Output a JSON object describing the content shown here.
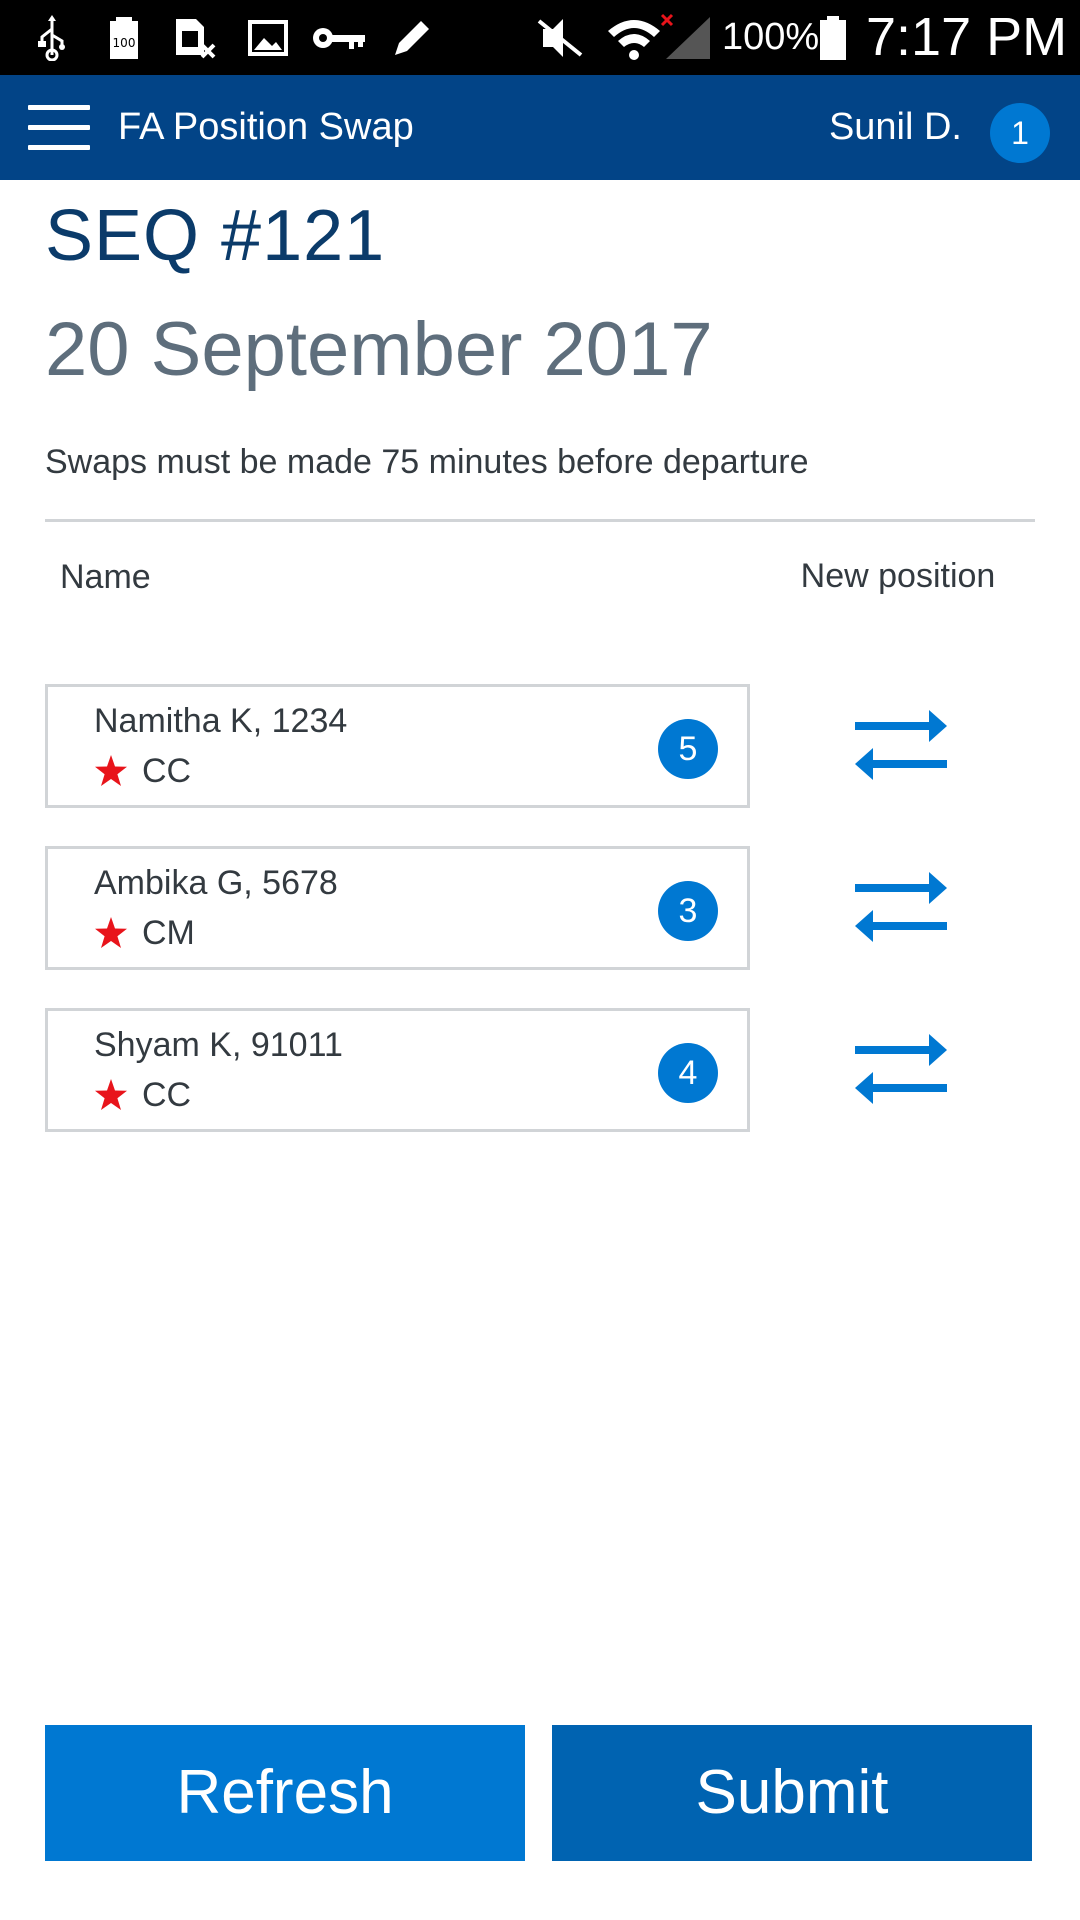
{
  "status_bar": {
    "battery_percent": "100%",
    "time": "7:17 PM",
    "icons": [
      "usb-icon",
      "battery-100-icon",
      "sim-card-x-icon",
      "image-icon",
      "key-icon",
      "pencil-icon",
      "mute-icon",
      "wifi-icon",
      "signal-no-service-icon",
      "battery-icon"
    ]
  },
  "app_bar": {
    "title": "FA Position Swap",
    "user_name": "Sunil D.",
    "user_badge": "1"
  },
  "sequence": {
    "title": "SEQ #121",
    "date": "20 September 2017",
    "note": "Swaps must be made 75 minutes before departure"
  },
  "table": {
    "col_name": "Name",
    "col_new_position": "New position",
    "rows": [
      {
        "name": "Namitha K, 1234",
        "role": "CC",
        "position": "5"
      },
      {
        "name": "Ambika G, 5678",
        "role": "CM",
        "position": "3"
      },
      {
        "name": "Shyam K, 91011",
        "role": "CC",
        "position": "4"
      }
    ]
  },
  "buttons": {
    "refresh": "Refresh",
    "submit": "Submit"
  },
  "colors": {
    "app_bar": "#024487",
    "accent": "#0078d2",
    "submit": "#0063b1",
    "star": "#e8141b",
    "seq_title": "#0b3b6a",
    "date": "#5e6e7c"
  }
}
